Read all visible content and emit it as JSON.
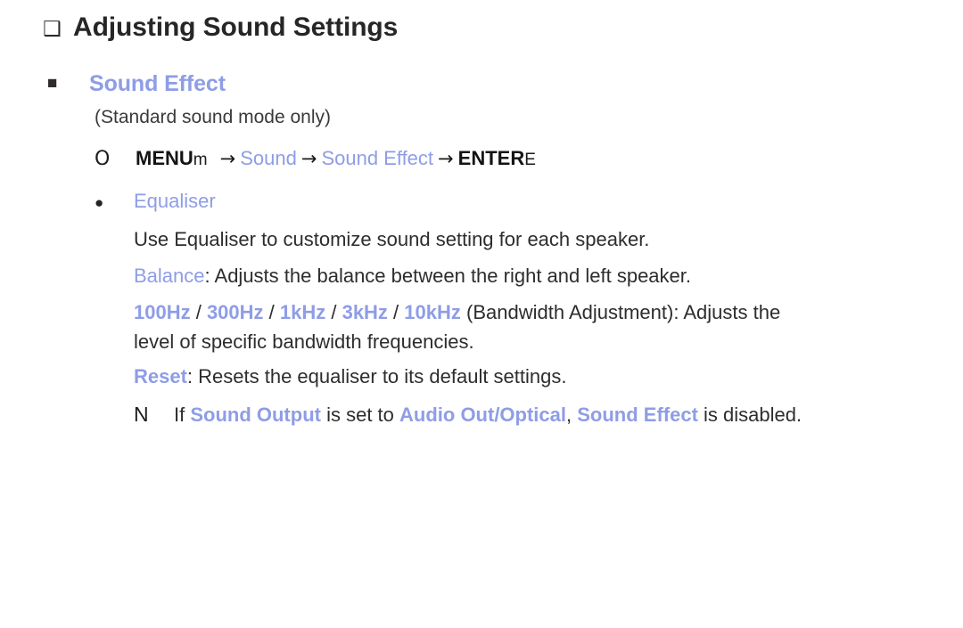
{
  "page": {
    "background": "#ffffff",
    "accent_color": "#8e9de6",
    "text_color": "#2d2d2d"
  },
  "title": {
    "bullet": "❑",
    "text": "Adjusting Sound Settings"
  },
  "section": {
    "bullet": "■",
    "heading": "Sound Effect",
    "subnote": "(Standard sound mode only)"
  },
  "menu_path": {
    "marker": "O",
    "menu_label": "MENU",
    "menu_suffix": "m",
    "arrow": "→",
    "step1": "Sound",
    "step2": "Sound Effect",
    "enter_label": "ENTER",
    "enter_suffix": "E"
  },
  "equaliser": {
    "bullet": "●",
    "title": "Equaliser",
    "description": "Use Equaliser to customize sound setting for each speaker.",
    "balance_term": "Balance",
    "balance_desc": ": Adjusts the balance between the right and left speaker.",
    "frequencies": [
      "100Hz",
      "300Hz",
      "1kHz",
      "3kHz",
      "10kHz"
    ],
    "frequency_separator": " / ",
    "bandwidth_desc": " (Bandwidth Adjustment): Adjusts the",
    "bandwidth_desc_wrap": "level of specific bandwidth frequencies.",
    "reset_term": "Reset",
    "reset_desc": ": Resets the equaliser to its default settings."
  },
  "note": {
    "marker": "N",
    "prefix": "If ",
    "term1": "Sound Output",
    "mid1": " is set to ",
    "term2": "Audio Out/Optical",
    "mid2": ", ",
    "term3": "Sound Effect",
    "suffix": " is disabled."
  }
}
